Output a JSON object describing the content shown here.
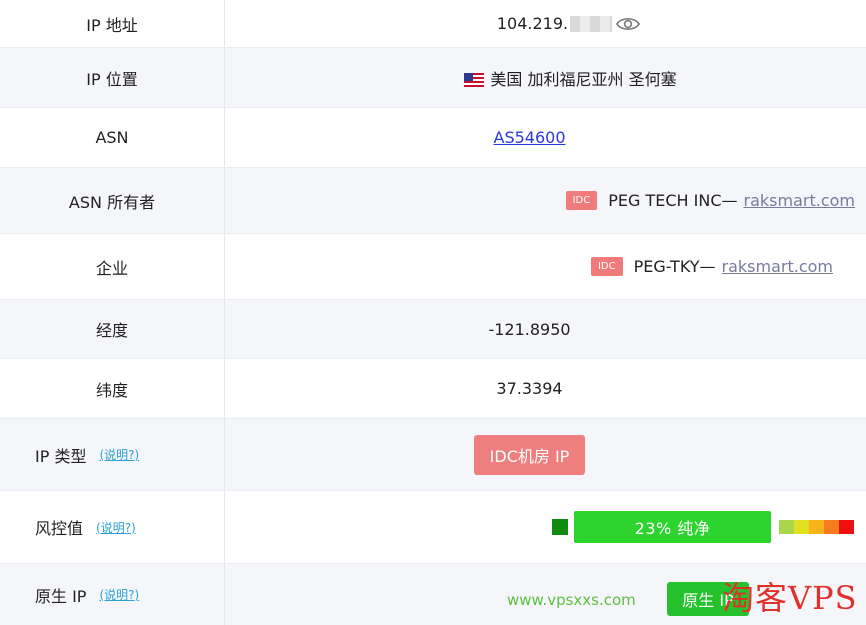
{
  "rows": {
    "ip_address": {
      "label": "IP 地址",
      "value": "104.219."
    },
    "ip_location": {
      "label": "IP 位置",
      "value": "美国 加利福尼亚州 圣何塞"
    },
    "asn": {
      "label": "ASN",
      "value": "AS54600"
    },
    "asn_owner": {
      "label": "ASN 所有者",
      "badge": "IDC",
      "name": "PEG TECH INC—",
      "link": "raksmart.com"
    },
    "company": {
      "label": "企业",
      "badge": "IDC",
      "name": "PEG-TKY—",
      "link": "raksmart.com"
    },
    "longitude": {
      "label": "经度",
      "value": "-121.8950"
    },
    "latitude": {
      "label": "纬度",
      "value": "37.3394"
    },
    "ip_type": {
      "label": "IP 类型",
      "help": "(说明?)",
      "value": "IDC机房 IP"
    },
    "risk": {
      "label": "风控值",
      "help": "(说明?)",
      "value": "23%  纯净",
      "percent": 23
    },
    "native_ip": {
      "label": "原生 IP",
      "help": "(说明?)",
      "value": "原生 IP"
    }
  },
  "risk_scale_colors": [
    "#a8d84a",
    "#dfe020",
    "#f7b21c",
    "#f57d1f",
    "#ee1010"
  ],
  "accent_colors": {
    "idc_badge": "#ef7b7b",
    "risk_green": "#2dd42d",
    "native_green": "#26c22e"
  },
  "watermark": {
    "url": "www.vpsxxs.com",
    "logo": "淘客VPS"
  }
}
